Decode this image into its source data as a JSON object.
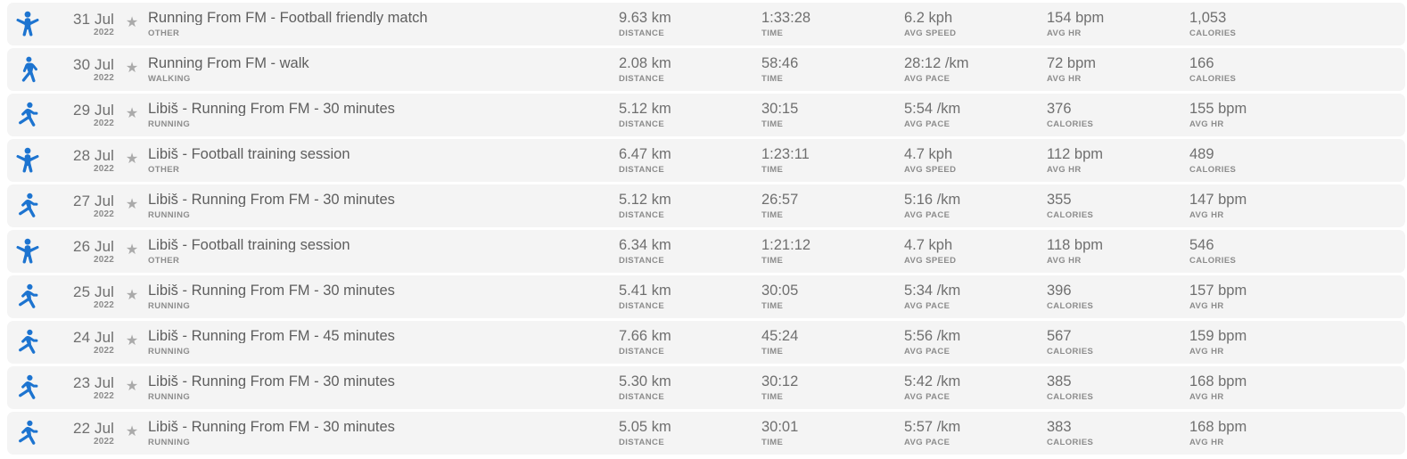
{
  "theme": {
    "row_background": "#f4f4f4",
    "page_background": "#ffffff",
    "icon_blue": "#1d74d0",
    "star_gray": "#aaaaaa",
    "value_gray": "#6f6f6f",
    "label_gray": "#8c8c8c"
  },
  "icons": {
    "star": "★",
    "other": "other-activity-icon",
    "walking": "walking-icon",
    "running": "running-icon"
  },
  "activities": [
    {
      "icon": "other",
      "date_day": "31 Jul",
      "date_year": "2022",
      "title": "Running From FM - Football friendly match",
      "sport": "OTHER",
      "metrics": [
        {
          "value": "9.63 km",
          "label": "DISTANCE"
        },
        {
          "value": "1:33:28",
          "label": "TIME"
        },
        {
          "value": "6.2 kph",
          "label": "AVG SPEED"
        },
        {
          "value": "154 bpm",
          "label": "AVG HR"
        },
        {
          "value": "1,053",
          "label": "CALORIES"
        }
      ]
    },
    {
      "icon": "walking",
      "date_day": "30 Jul",
      "date_year": "2022",
      "title": "Running From FM - walk",
      "sport": "WALKING",
      "metrics": [
        {
          "value": "2.08 km",
          "label": "DISTANCE"
        },
        {
          "value": "58:46",
          "label": "TIME"
        },
        {
          "value": "28:12 /km",
          "label": "AVG PACE"
        },
        {
          "value": "72 bpm",
          "label": "AVG HR"
        },
        {
          "value": "166",
          "label": "CALORIES"
        }
      ]
    },
    {
      "icon": "running",
      "date_day": "29 Jul",
      "date_year": "2022",
      "title": "Libiš - Running From FM - 30 minutes",
      "sport": "RUNNING",
      "metrics": [
        {
          "value": "5.12 km",
          "label": "DISTANCE"
        },
        {
          "value": "30:15",
          "label": "TIME"
        },
        {
          "value": "5:54 /km",
          "label": "AVG PACE"
        },
        {
          "value": "376",
          "label": "CALORIES"
        },
        {
          "value": "155 bpm",
          "label": "AVG HR"
        }
      ]
    },
    {
      "icon": "other",
      "date_day": "28 Jul",
      "date_year": "2022",
      "title": "Libiš - Football training session",
      "sport": "OTHER",
      "metrics": [
        {
          "value": "6.47 km",
          "label": "DISTANCE"
        },
        {
          "value": "1:23:11",
          "label": "TIME"
        },
        {
          "value": "4.7 kph",
          "label": "AVG SPEED"
        },
        {
          "value": "112 bpm",
          "label": "AVG HR"
        },
        {
          "value": "489",
          "label": "CALORIES"
        }
      ]
    },
    {
      "icon": "running",
      "date_day": "27 Jul",
      "date_year": "2022",
      "title": "Libiš - Running From FM - 30 minutes",
      "sport": "RUNNING",
      "metrics": [
        {
          "value": "5.12 km",
          "label": "DISTANCE"
        },
        {
          "value": "26:57",
          "label": "TIME"
        },
        {
          "value": "5:16 /km",
          "label": "AVG PACE"
        },
        {
          "value": "355",
          "label": "CALORIES"
        },
        {
          "value": "147 bpm",
          "label": "AVG HR"
        }
      ]
    },
    {
      "icon": "other",
      "date_day": "26 Jul",
      "date_year": "2022",
      "title": "Libiš - Football training session",
      "sport": "OTHER",
      "metrics": [
        {
          "value": "6.34 km",
          "label": "DISTANCE"
        },
        {
          "value": "1:21:12",
          "label": "TIME"
        },
        {
          "value": "4.7 kph",
          "label": "AVG SPEED"
        },
        {
          "value": "118 bpm",
          "label": "AVG HR"
        },
        {
          "value": "546",
          "label": "CALORIES"
        }
      ]
    },
    {
      "icon": "running",
      "date_day": "25 Jul",
      "date_year": "2022",
      "title": "Libiš - Running From FM - 30 minutes",
      "sport": "RUNNING",
      "metrics": [
        {
          "value": "5.41 km",
          "label": "DISTANCE"
        },
        {
          "value": "30:05",
          "label": "TIME"
        },
        {
          "value": "5:34 /km",
          "label": "AVG PACE"
        },
        {
          "value": "396",
          "label": "CALORIES"
        },
        {
          "value": "157 bpm",
          "label": "AVG HR"
        }
      ]
    },
    {
      "icon": "running",
      "date_day": "24 Jul",
      "date_year": "2022",
      "title": "Libiš - Running From FM - 45 minutes",
      "sport": "RUNNING",
      "metrics": [
        {
          "value": "7.66 km",
          "label": "DISTANCE"
        },
        {
          "value": "45:24",
          "label": "TIME"
        },
        {
          "value": "5:56 /km",
          "label": "AVG PACE"
        },
        {
          "value": "567",
          "label": "CALORIES"
        },
        {
          "value": "159 bpm",
          "label": "AVG HR"
        }
      ]
    },
    {
      "icon": "running",
      "date_day": "23 Jul",
      "date_year": "2022",
      "title": "Libiš - Running From FM - 30 minutes",
      "sport": "RUNNING",
      "metrics": [
        {
          "value": "5.30 km",
          "label": "DISTANCE"
        },
        {
          "value": "30:12",
          "label": "TIME"
        },
        {
          "value": "5:42 /km",
          "label": "AVG PACE"
        },
        {
          "value": "385",
          "label": "CALORIES"
        },
        {
          "value": "168 bpm",
          "label": "AVG HR"
        }
      ]
    },
    {
      "icon": "running",
      "date_day": "22 Jul",
      "date_year": "2022",
      "title": "Libiš - Running From FM - 30 minutes",
      "sport": "RUNNING",
      "metrics": [
        {
          "value": "5.05 km",
          "label": "DISTANCE"
        },
        {
          "value": "30:01",
          "label": "TIME"
        },
        {
          "value": "5:57 /km",
          "label": "AVG PACE"
        },
        {
          "value": "383",
          "label": "CALORIES"
        },
        {
          "value": "168 bpm",
          "label": "AVG HR"
        }
      ]
    }
  ]
}
